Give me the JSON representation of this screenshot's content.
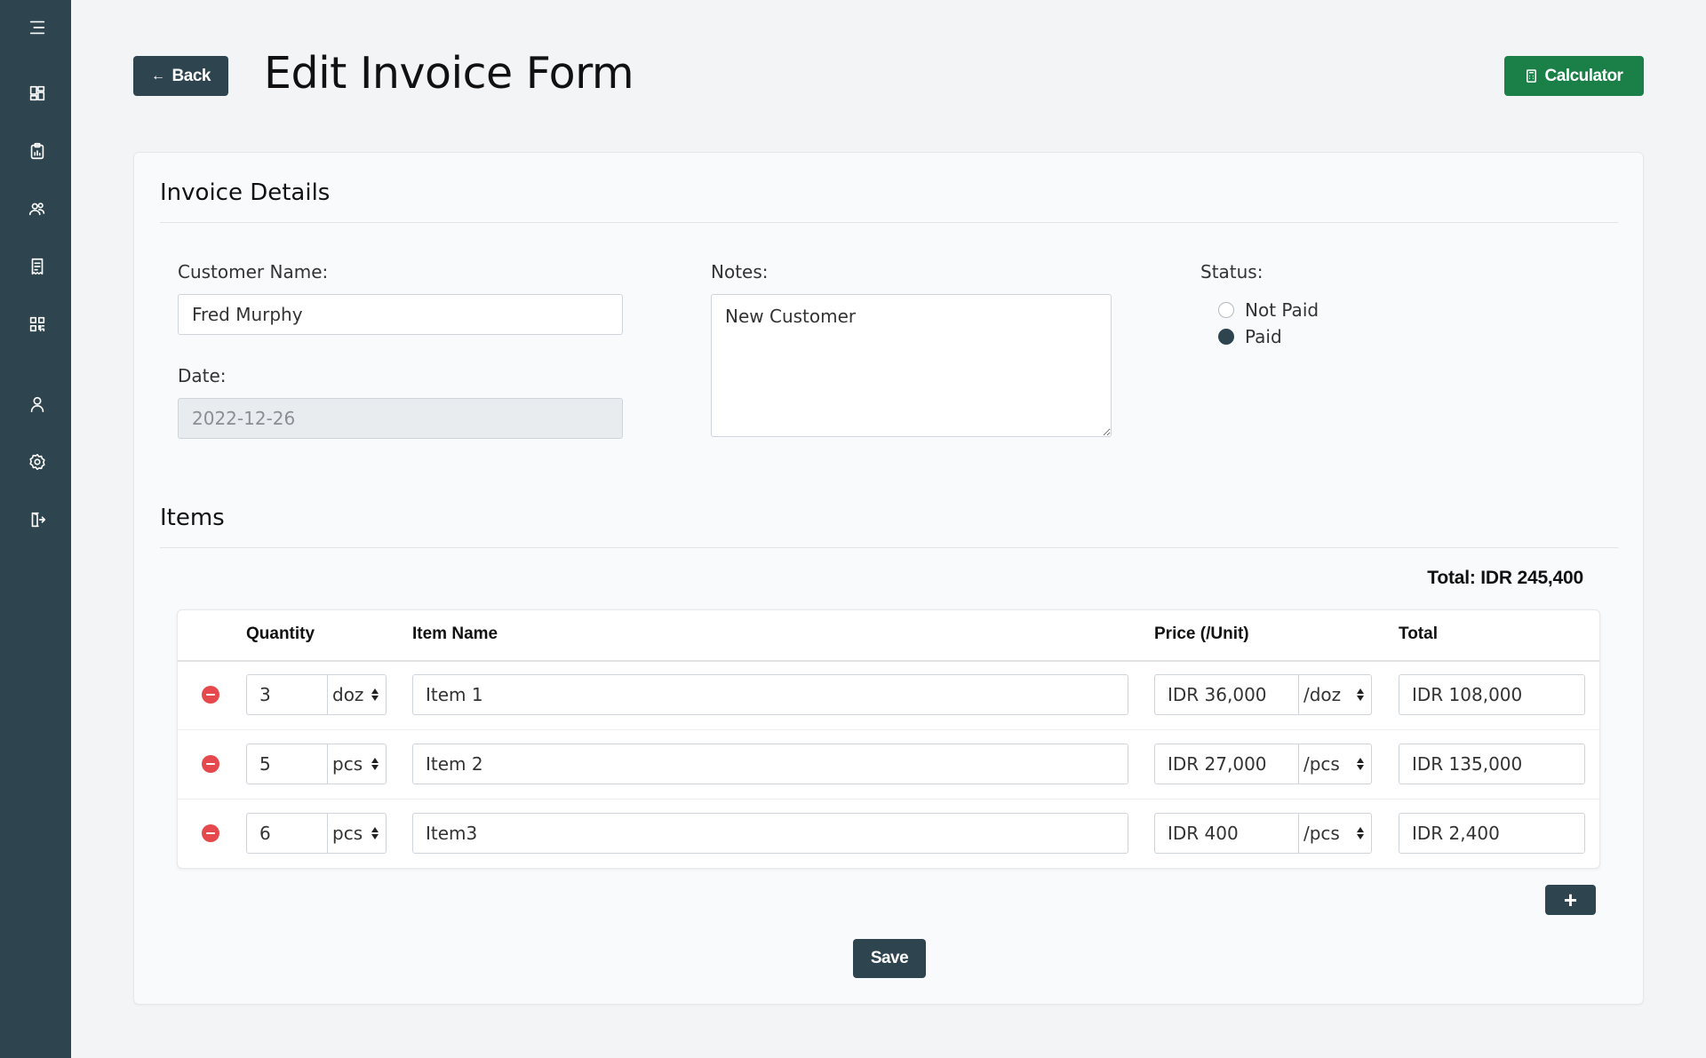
{
  "header": {
    "back_label": "Back",
    "back_icon": "arrow-left-icon",
    "title": "Edit Invoice Form",
    "calculator_label": "Calculator",
    "calculator_icon": "calculator-icon"
  },
  "sidebar": {
    "items": [
      {
        "icon": "menu-icon"
      },
      {
        "icon": "dashboard-icon"
      },
      {
        "icon": "clipboard-report-icon"
      },
      {
        "icon": "users-icon"
      },
      {
        "icon": "invoice-icon"
      },
      {
        "icon": "qr-code-icon"
      },
      {
        "icon": "user-icon"
      },
      {
        "icon": "settings-icon"
      },
      {
        "icon": "logout-icon"
      }
    ]
  },
  "invoice": {
    "section_title": "Invoice Details",
    "customer_label": "Customer Name:",
    "customer_value": "Fred Murphy",
    "date_label": "Date:",
    "date_value": "2022-12-26",
    "notes_label": "Notes:",
    "notes_value": "New Customer",
    "status_label": "Status:",
    "status_options": [
      "Not Paid",
      "Paid"
    ],
    "status_selected": "Paid"
  },
  "items": {
    "section_title": "Items",
    "total_text": "Total: IDR 245,400",
    "columns": [
      "Quantity",
      "Item Name",
      "Price (/Unit)",
      "Total"
    ],
    "rows": [
      {
        "qty": "3",
        "unit": "doz",
        "name": "Item 1",
        "price": "IDR 36,000",
        "price_unit": "/doz",
        "total": "IDR 108,000"
      },
      {
        "qty": "5",
        "unit": "pcs",
        "name": "Item 2",
        "price": "IDR 27,000",
        "price_unit": "/pcs",
        "total": "IDR 135,000"
      },
      {
        "qty": "6",
        "unit": "pcs",
        "name": "Item3",
        "price": "IDR 400",
        "price_unit": "/pcs",
        "total": "IDR 2,400"
      }
    ],
    "add_label": "+",
    "save_label": "Save"
  },
  "colors": {
    "sidebar": "#2e4550",
    "primary": "#2e4550",
    "success": "#1a8048",
    "danger": "#e5484d"
  }
}
